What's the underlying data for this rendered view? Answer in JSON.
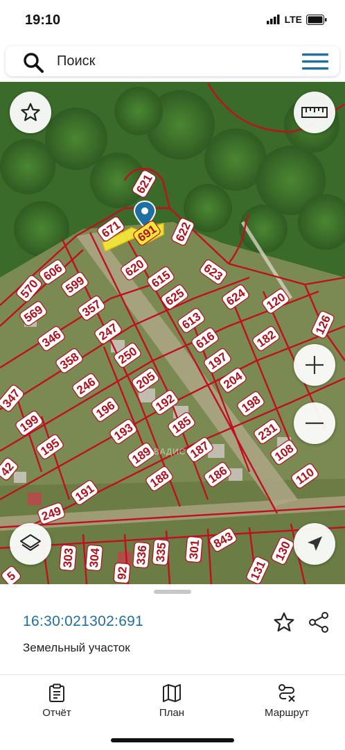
{
  "status": {
    "time": "19:10",
    "network": "LTE"
  },
  "search": {
    "label": "Поиск"
  },
  "map": {
    "watermark": "ВАДИС",
    "selected_parcel": "691",
    "parcel_labels": [
      "621",
      "671",
      "691",
      "622",
      "606",
      "570",
      "599",
      "620",
      "615",
      "623",
      "569",
      "357",
      "625",
      "624",
      "120",
      "346",
      "247",
      "613",
      "182",
      "126",
      "358",
      "250",
      "616",
      "197",
      "347",
      "246",
      "205",
      "204",
      "199",
      "196",
      "192",
      "198",
      "195",
      "193",
      "185",
      "231",
      "42",
      "189",
      "187",
      "108",
      "188",
      "186",
      "110",
      "191",
      "249",
      "843",
      "303",
      "304",
      "336",
      "335",
      "301",
      "130",
      "92",
      "131",
      "5"
    ]
  },
  "info_sheet": {
    "cadastral_number": "16:30:021302:691",
    "parcel_type": "Земельный участок"
  },
  "tabs": [
    {
      "label": "Отчёт",
      "icon": "report-icon"
    },
    {
      "label": "План",
      "icon": "map-plan-icon"
    },
    {
      "label": "Маршрут",
      "icon": "route-icon"
    }
  ],
  "colors": {
    "accent": "#1f6fa3",
    "parcel_border": "#b1101a",
    "selected_parcel": "#f5e63a"
  }
}
